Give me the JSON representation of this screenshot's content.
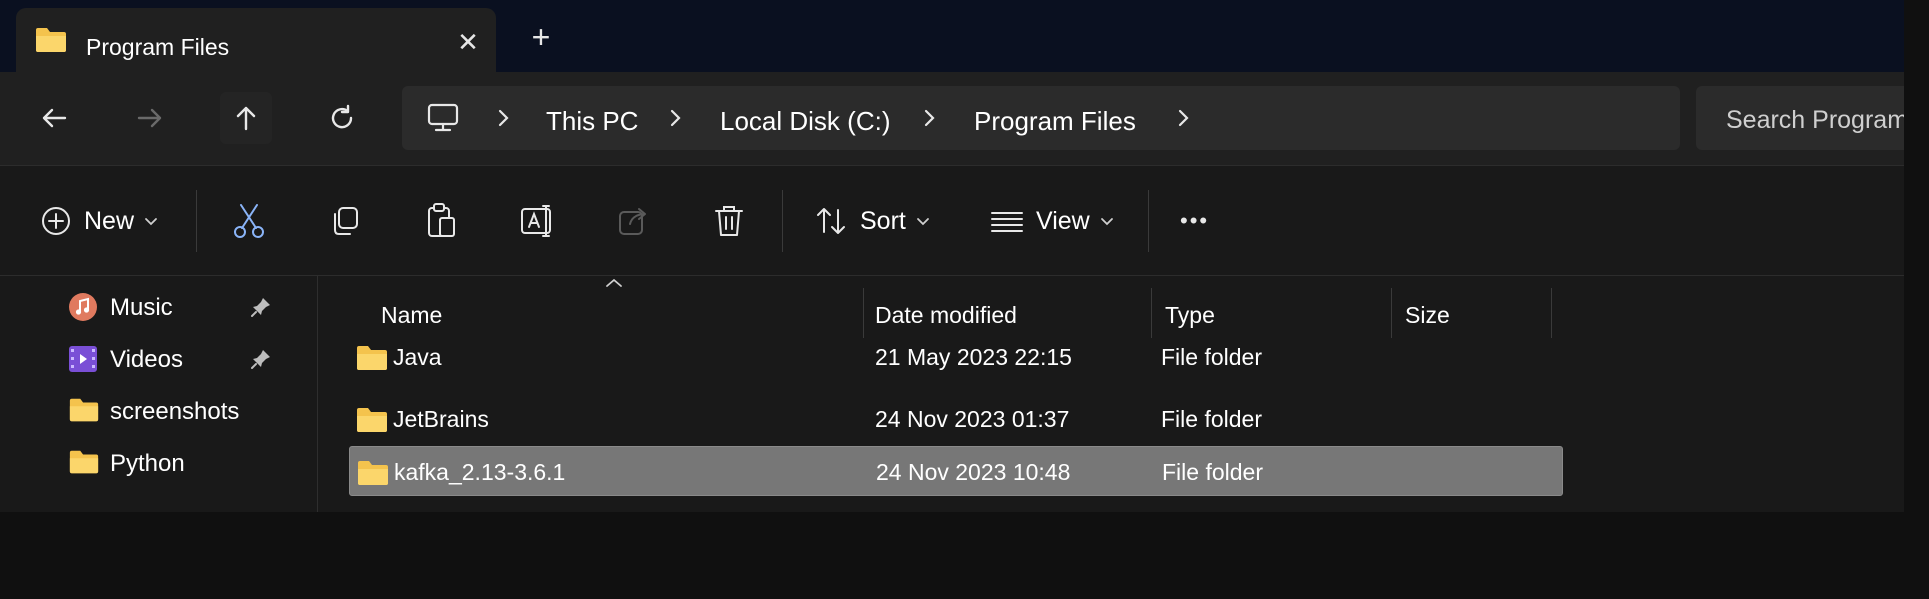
{
  "tab": {
    "title": "Program Files",
    "close_glyph": "✕",
    "new_tab_glyph": "+"
  },
  "address": {
    "crumbs": [
      "This PC",
      "Local Disk (C:)",
      "Program Files"
    ]
  },
  "search": {
    "placeholder": "Search Program Files"
  },
  "commands": {
    "new_label": "New",
    "sort_label": "Sort",
    "view_label": "View",
    "more_glyph": "•••"
  },
  "sidebar": {
    "items": [
      {
        "label": "Music",
        "icon": "music-icon",
        "pinned": true
      },
      {
        "label": "Videos",
        "icon": "videos-icon",
        "pinned": true
      },
      {
        "label": "screenshots",
        "icon": "folder-icon",
        "pinned": false
      },
      {
        "label": "Python",
        "icon": "folder-icon",
        "pinned": false
      }
    ]
  },
  "columns": [
    "Name",
    "Date modified",
    "Type",
    "Size"
  ],
  "files": [
    {
      "name": "Java",
      "date": "21 May 2023 22:15",
      "type": "File folder",
      "selected": false
    },
    {
      "name": "JetBrains",
      "date": "24 Nov 2023 01:37",
      "type": "File folder",
      "selected": false
    },
    {
      "name": "kafka_2.13-3.6.1",
      "date": "24 Nov 2023 10:48",
      "type": "File folder",
      "selected": true
    }
  ],
  "colors": {
    "titlebar": "#0a1020",
    "surface": "#191919",
    "navbar": "#202020",
    "address": "#2b2b2b",
    "selected_row": "#777777",
    "folder_yellow": "#f4c34d"
  }
}
